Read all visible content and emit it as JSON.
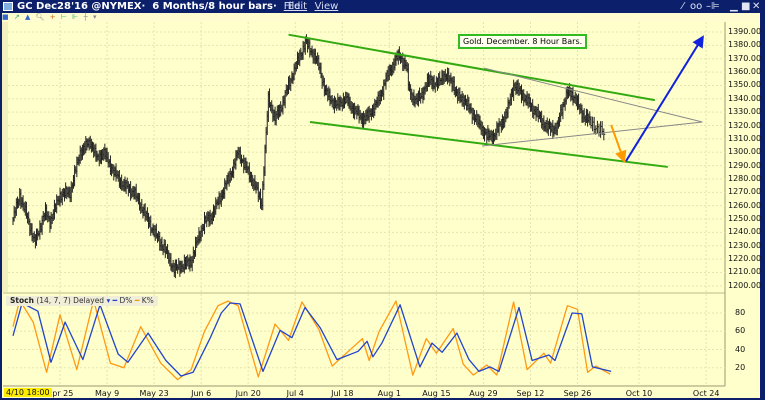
{
  "window": {
    "title": "GC Dec28'16 @NYMEX",
    "period": "6 Months/8 hour bars",
    "menu": [
      "File",
      "Edit",
      "View"
    ],
    "controls": [
      "wrench",
      "link",
      "pin",
      "minimize",
      "maximize",
      "close"
    ]
  },
  "annotation_label": "Gold. December. 8 Hour Bars.",
  "start_label": "4/10 18:00",
  "stoch_legend": {
    "name": "Stoch",
    "params": "(14, 7, 7) Delayed",
    "d": "D%",
    "k": "K%"
  },
  "colors": {
    "bg": "#ffffcc",
    "grid": "#e6e3b0",
    "bars": "#222222",
    "channel": "#33aa11",
    "apex": "#888888",
    "down_arrow": "#ff9900",
    "up_arrow": "#1122dd",
    "d_line": "#2244cc",
    "k_line": "#ff9911"
  },
  "chart_data": [
    {
      "type": "ohlc",
      "title": "Gold. December. 8 Hour Bars.",
      "x_unit": "days since Apr 11 2016",
      "ylim": [
        1200,
        1390
      ],
      "y_ticks": [
        "1390.00",
        "1380.00",
        "1370.00",
        "1360.00",
        "1350.00",
        "1340.00",
        "1330.00",
        "1320.00",
        "1310.00",
        "1300.00",
        "1290.00",
        "1280.00",
        "1270.00",
        "1260.00",
        "1250.00",
        "1240.00",
        "1230.00",
        "1220.00",
        "1210.00",
        "1200.00"
      ],
      "x_ticks": [
        {
          "day": 14,
          "label": "Apr 25"
        },
        {
          "day": 28,
          "label": "May 9"
        },
        {
          "day": 42,
          "label": "May 23"
        },
        {
          "day": 56,
          "label": "Jun 6"
        },
        {
          "day": 70,
          "label": "Jun 20"
        },
        {
          "day": 84,
          "label": "Jul 4"
        },
        {
          "day": 98,
          "label": "Jul 18"
        },
        {
          "day": 112,
          "label": "Aug 1"
        },
        {
          "day": 126,
          "label": "Aug 15"
        },
        {
          "day": 140,
          "label": "Aug 29"
        },
        {
          "day": 154,
          "label": "Sep 12"
        },
        {
          "day": 168,
          "label": "Sep 26"
        },
        {
          "day": 182,
          "label": "Oct 10"
        },
        {
          "day": 196,
          "label": "Oct 24"
        }
      ],
      "price_path": [
        [
          0,
          1250
        ],
        [
          2,
          1268
        ],
        [
          5,
          1245
        ],
        [
          6.5,
          1232
        ],
        [
          9.5,
          1255
        ],
        [
          11,
          1248
        ],
        [
          14,
          1268
        ],
        [
          17,
          1270
        ],
        [
          20,
          1300
        ],
        [
          23,
          1308
        ],
        [
          25,
          1295
        ],
        [
          27,
          1300
        ],
        [
          30,
          1285
        ],
        [
          33,
          1275
        ],
        [
          36,
          1270
        ],
        [
          39,
          1255
        ],
        [
          42,
          1240
        ],
        [
          45,
          1228
        ],
        [
          48,
          1212
        ],
        [
          50,
          1215
        ],
        [
          53,
          1218
        ],
        [
          55,
          1235
        ],
        [
          57,
          1248
        ],
        [
          59,
          1252
        ],
        [
          62,
          1268
        ],
        [
          65,
          1285
        ],
        [
          67,
          1300
        ],
        [
          69,
          1290
        ],
        [
          72,
          1275
        ],
        [
          74,
          1262
        ],
        [
          76,
          1340
        ],
        [
          78,
          1325
        ],
        [
          80,
          1335
        ],
        [
          82,
          1350
        ],
        [
          85,
          1370
        ],
        [
          87,
          1382
        ],
        [
          89,
          1375
        ],
        [
          91,
          1365
        ],
        [
          93,
          1345
        ],
        [
          96,
          1335
        ],
        [
          99,
          1340
        ],
        [
          102,
          1330
        ],
        [
          104,
          1325
        ],
        [
          106,
          1328
        ],
        [
          109,
          1340
        ],
        [
          111,
          1355
        ],
        [
          114,
          1370
        ],
        [
          115,
          1372
        ],
        [
          117,
          1365
        ],
        [
          118,
          1345
        ],
        [
          120,
          1338
        ],
        [
          122,
          1345
        ],
        [
          124,
          1355
        ],
        [
          126,
          1350
        ],
        [
          128,
          1358
        ],
        [
          131,
          1352
        ],
        [
          132,
          1342
        ],
        [
          134,
          1340
        ],
        [
          136,
          1332
        ],
        [
          139,
          1320
        ],
        [
          141,
          1312
        ],
        [
          143,
          1312
        ],
        [
          145,
          1320
        ],
        [
          147,
          1330
        ],
        [
          149,
          1350
        ],
        [
          151,
          1345
        ],
        [
          154,
          1335
        ],
        [
          157,
          1325
        ],
        [
          159,
          1318
        ],
        [
          162,
          1318
        ],
        [
          163,
          1330
        ],
        [
          165,
          1345
        ],
        [
          167,
          1342
        ],
        [
          169,
          1330
        ],
        [
          172,
          1322
        ],
        [
          174,
          1316
        ],
        [
          175,
          1312
        ]
      ],
      "drawings": [
        {
          "kind": "channel-upper",
          "from": [
            82,
            1388
          ],
          "to": [
            185.3,
            1339
          ]
        },
        {
          "kind": "channel-lower",
          "from": [
            88.4,
            1322.6
          ],
          "to": [
            188,
            1289
          ]
        },
        {
          "kind": "apex-upper",
          "from": [
            140.2,
            1363
          ],
          "to": [
            195.2,
            1322.6
          ]
        },
        {
          "kind": "apex-lower",
          "from": [
            139.6,
            1304.7
          ],
          "to": [
            195.2,
            1322.6
          ]
        },
        {
          "kind": "down-arrow",
          "from": [
            176.2,
            1320.4
          ],
          "to": [
            178.9,
            1293.4
          ]
        },
        {
          "kind": "up-arrow",
          "from": [
            179.3,
            1293.4
          ],
          "to": [
            195.3,
            1386.3
          ]
        }
      ]
    },
    {
      "type": "line",
      "title": "Stoch (14, 7, 7) Delayed",
      "ylim": [
        0,
        100
      ],
      "y_ticks": [
        "80",
        "60",
        "40",
        "20"
      ],
      "series": [
        {
          "name": "D%",
          "points": [
            [
              0,
              55
            ],
            [
              2.7,
              91
            ],
            [
              7.4,
              82
            ],
            [
              11.3,
              26
            ],
            [
              15.5,
              70
            ],
            [
              20.8,
              29
            ],
            [
              25.9,
              89
            ],
            [
              31.3,
              35
            ],
            [
              34.2,
              26
            ],
            [
              40.2,
              58
            ],
            [
              45.5,
              28
            ],
            [
              50,
              11
            ],
            [
              53.6,
              15
            ],
            [
              58.6,
              52
            ],
            [
              62,
              80
            ],
            [
              64.6,
              91
            ],
            [
              67.6,
              90
            ],
            [
              74.4,
              16
            ],
            [
              79.5,
              61
            ],
            [
              83,
              53
            ],
            [
              86.9,
              86
            ],
            [
              91.4,
              64
            ],
            [
              96.4,
              29
            ],
            [
              102.7,
              38
            ],
            [
              105.4,
              49
            ],
            [
              107.1,
              32
            ],
            [
              109.8,
              47
            ],
            [
              115.2,
              89
            ],
            [
              121.1,
              21
            ],
            [
              124.7,
              47
            ],
            [
              127.7,
              37
            ],
            [
              132.1,
              58
            ],
            [
              135.7,
              29
            ],
            [
              138.7,
              16
            ],
            [
              142,
              21
            ],
            [
              144.6,
              16
            ],
            [
              150.6,
              86
            ],
            [
              154.5,
              28
            ],
            [
              159.5,
              34
            ],
            [
              161.3,
              28
            ],
            [
              166.4,
              80
            ],
            [
              169.3,
              79
            ],
            [
              172.3,
              21
            ],
            [
              176.2,
              16
            ]
          ]
        },
        {
          "name": "K%",
          "points": [
            [
              0,
              65
            ],
            [
              2,
              94
            ],
            [
              6,
              70
            ],
            [
              10,
              15
            ],
            [
              14,
              78
            ],
            [
              19,
              18
            ],
            [
              24,
              94
            ],
            [
              29,
              25
            ],
            [
              33,
              20
            ],
            [
              38,
              65
            ],
            [
              44,
              25
            ],
            [
              49,
              7
            ],
            [
              53,
              18
            ],
            [
              57,
              60
            ],
            [
              61,
              88
            ],
            [
              64,
              93
            ],
            [
              67,
              88
            ],
            [
              73,
              10
            ],
            [
              78,
              68
            ],
            [
              82,
              50
            ],
            [
              86,
              92
            ],
            [
              91,
              62
            ],
            [
              95,
              22
            ],
            [
              101,
              42
            ],
            [
              104,
              52
            ],
            [
              106,
              28
            ],
            [
              109,
              60
            ],
            [
              114,
              93
            ],
            [
              119,
              12
            ],
            [
              123,
              52
            ],
            [
              126,
              36
            ],
            [
              131,
              63
            ],
            [
              134,
              24
            ],
            [
              137,
              12
            ],
            [
              141,
              23
            ],
            [
              144,
              12
            ],
            [
              149,
              92
            ],
            [
              153,
              18
            ],
            [
              158,
              36
            ],
            [
              160,
              25
            ],
            [
              165,
              88
            ],
            [
              168,
              84
            ],
            [
              171,
              15
            ],
            [
              173,
              22
            ],
            [
              176,
              13
            ]
          ]
        }
      ]
    }
  ]
}
